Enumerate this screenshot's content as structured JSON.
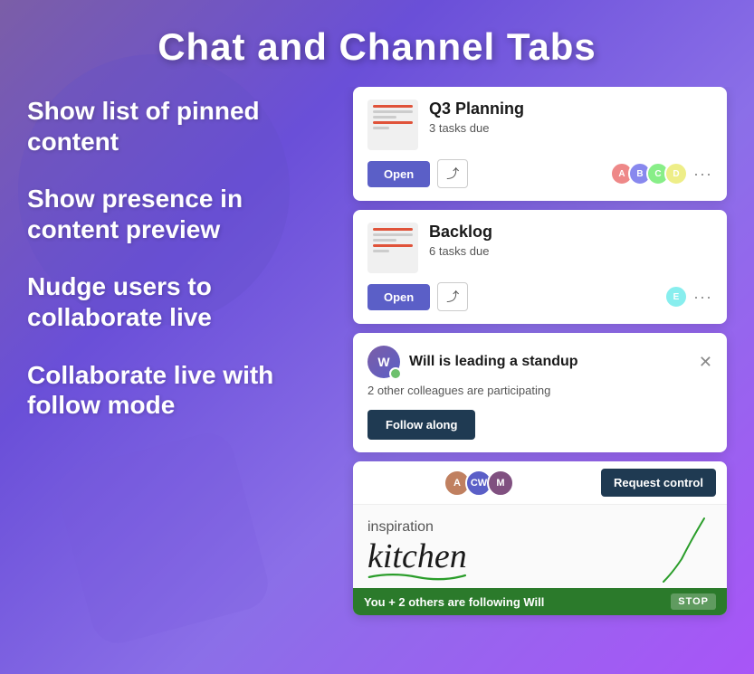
{
  "page": {
    "title": "Chat and Channel Tabs"
  },
  "features": [
    {
      "id": "pinned",
      "text": "Show list of pinned content"
    },
    {
      "id": "presence",
      "text": "Show presence in content preview"
    },
    {
      "id": "nudge",
      "text": "Nudge users to collaborate live"
    },
    {
      "id": "follow",
      "text": "Collaborate live with follow mode"
    }
  ],
  "cards": [
    {
      "id": "q3-planning",
      "title": "Q3 Planning",
      "subtitle": "3 tasks due",
      "openLabel": "Open",
      "avatars": 4
    },
    {
      "id": "backlog",
      "title": "Backlog",
      "subtitle": "6 tasks due",
      "openLabel": "Open",
      "avatars": 1
    }
  ],
  "standup": {
    "title": "Will is leading a standup",
    "subtitle": "2 other colleagues are participating",
    "followLabel": "Follow along"
  },
  "live": {
    "requestLabel": "Request control",
    "inspirationSmall": "inspiration",
    "inspirationLarge": "kitchen",
    "followingText": "You + 2 others are following Will",
    "stopLabel": "STOP"
  }
}
